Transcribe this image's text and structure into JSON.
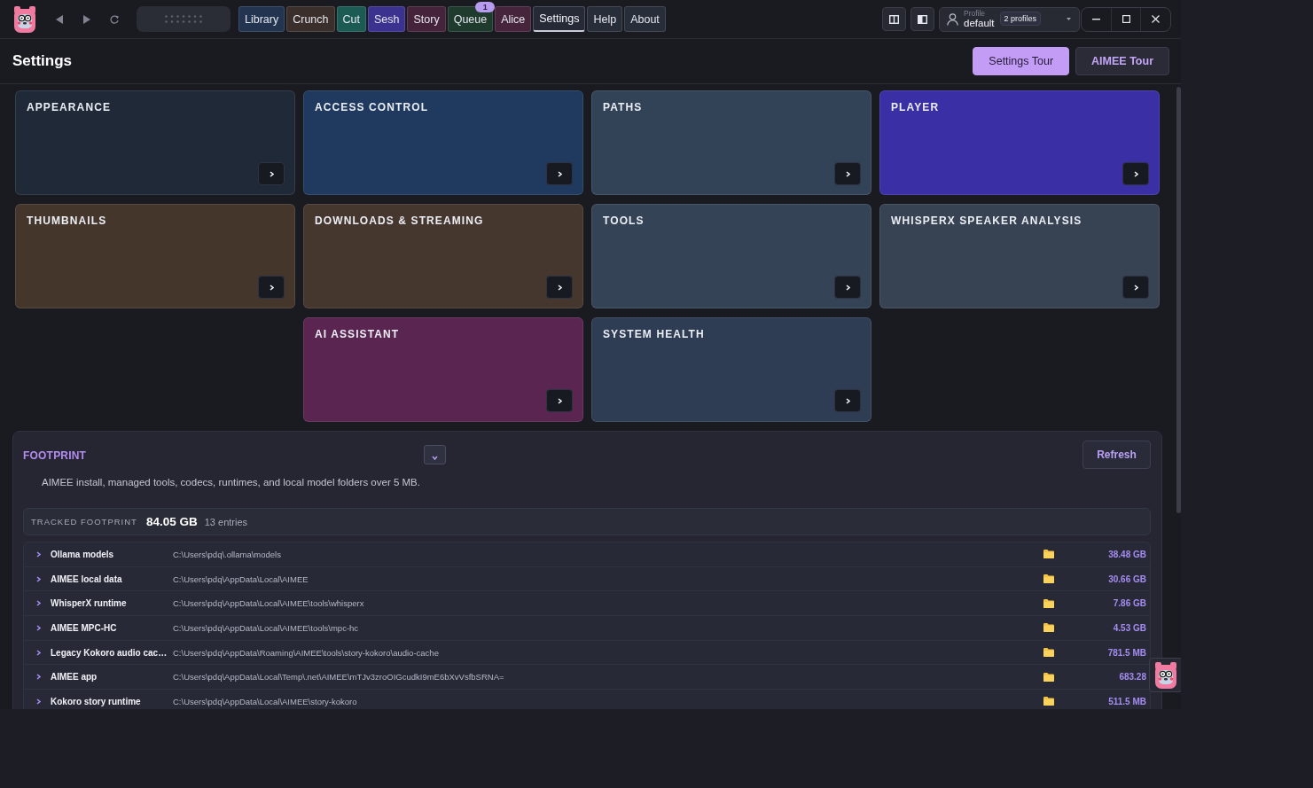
{
  "app": {
    "tabs": [
      {
        "label": "Library",
        "color": "#223450",
        "selected": false
      },
      {
        "label": "Crunch",
        "color": "#3a2f2b",
        "selected": false
      },
      {
        "label": "Cut",
        "color": "#1c5b53",
        "selected": false
      },
      {
        "label": "Sesh",
        "color": "#3b318e",
        "selected": false
      },
      {
        "label": "Story",
        "color": "#45233a",
        "selected": false
      },
      {
        "label": "Queue",
        "color": "#1f3b2e",
        "selected": false,
        "badge": "1"
      },
      {
        "label": "Alice",
        "color": "#46243c",
        "selected": false
      },
      {
        "label": "Settings",
        "color": "#262a36",
        "selected": true
      },
      {
        "label": "Help",
        "color": "#282d3a",
        "selected": false
      },
      {
        "label": "About",
        "color": "#282d3a",
        "selected": false
      }
    ],
    "profile": {
      "label": "Profile",
      "value": "default",
      "count": "2 profiles"
    }
  },
  "page": {
    "title": "Settings",
    "tour_buttons": [
      {
        "label": "Settings Tour",
        "kind": "primary"
      },
      {
        "label": "AIMEE Tour",
        "kind": "secondary"
      }
    ]
  },
  "cards": [
    {
      "title": "APPEARANCE",
      "color": "#1f2938"
    },
    {
      "title": "ACCESS CONTROL",
      "color": "#1f3a5e"
    },
    {
      "title": "PATHS",
      "color": "#334357"
    },
    {
      "title": "PLAYER",
      "color": "#3a2fa5"
    },
    {
      "title": "THUMBNAILS",
      "color": "#45362c"
    },
    {
      "title": "DOWNLOADS & STREAMING",
      "color": "#45362e"
    },
    {
      "title": "TOOLS",
      "color": "#354357"
    },
    {
      "title": "WHISPERX SPEAKER ANALYSIS",
      "color": "#374352"
    },
    {
      "title": "AI ASSISTANT",
      "color": "#5a2550"
    },
    {
      "title": "SYSTEM HEALTH",
      "color": "#2e3d54"
    }
  ],
  "footprint": {
    "title": "FOOTPRINT",
    "expanded": true,
    "refresh": "Refresh",
    "description": "AIMEE install, managed tools, codecs, runtimes, and local model folders over 5 MB.",
    "summary": {
      "label": "TRACKED FOOTPRINT",
      "total": "84.05 GB",
      "entries": "13 entries"
    },
    "rows": [
      {
        "name": "Ollama models",
        "path": "C:\\Users\\pdq\\.ollama\\models",
        "size": "38.48 GB",
        "expanded": false
      },
      {
        "name": "AIMEE local data",
        "path": "C:\\Users\\pdq\\AppData\\Local\\AIMEE",
        "size": "30.66 GB",
        "expanded": false
      },
      {
        "name": "WhisperX runtime",
        "path": "C:\\Users\\pdq\\AppData\\Local\\AIMEE\\tools\\whisperx",
        "size": "7.86 GB",
        "expanded": false
      },
      {
        "name": "AIMEE MPC-HC",
        "path": "C:\\Users\\pdq\\AppData\\Local\\AIMEE\\tools\\mpc-hc",
        "size": "4.53 GB",
        "expanded": false
      },
      {
        "name": "Legacy Kokoro audio cac…",
        "path": "C:\\Users\\pdq\\AppData\\Roaming\\AIMEE\\tools\\story-kokoro\\audio-cache",
        "size": "781.5 MB",
        "expanded": false
      },
      {
        "name": "AIMEE app",
        "path": "C:\\Users\\pdq\\AppData\\Local\\Temp\\.net\\AIMEE\\mTJv3zroOIGcudkI9mE6bXvVsfbSRNA=",
        "size": "683.28",
        "expanded": false
      },
      {
        "name": "Kokoro story runtime",
        "path": "C:\\Users\\pdq\\AppData\\Local\\AIMEE\\story-kokoro",
        "size": "511.5 MB",
        "expanded": false
      }
    ]
  }
}
